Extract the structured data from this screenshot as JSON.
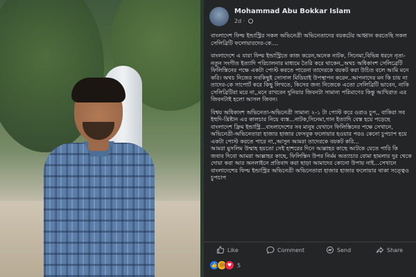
{
  "post": {
    "author": "Mohammad Abu Bokkar Islam",
    "time": "2d",
    "separator": "·",
    "paragraphs": [
      "বাংলাদেশ ফিল্ম ইন্ডাস্ট্রির সকল অভিনেত্রী অভিনেতাদের বয়কটের আহ্বান করতেছি সকল সেলিব্রিটি ফলোয়ারদের-কে....",
      "বাংলাদেশে এ যারা ফিল্ম ইন্ডাস্ট্রিতে কাজ করেন,অনেক নাটক, সিনেমা,বিভিন্ন ধরনে নৃত্য-নতুন সংগীত ইত্যাদি পরিচালনার মাধ্যমে তৈরি করে থাকেন,,অথচ অধিকাংশ সেলিব্রেটি ফিলিস্তিনের পক্ষে একটা পোস্ট করতে পারেনা তাদেরকে বয়কট করা উচিত বলে আমি মনে করি। অথচ নিজের সবকিছুই সোসাল মিডিয়াই উপস্থাপন করেন..আপনাদের মন কি চায় না তাদের-কে সাপোর্ট করে কিছু লিখতে, কিসের জন্য নিজেকে এতো সেলিব্রিটি ভাবেন, নাকি সেলিব্রিটিরা মরে না,,মনে রাখবেন দুনিয়ার জিবনটা সামান্য পরিমাণের কিন্তু আখিরাত এর জিবনটাই হলো আসল জিবন।",
      "বিশ্বয় অধিকাংশ অভিনেতা-অভিনেত্রী সামান্য ২-১ টা পোস্ট করে ওরাও চুপ,, বাকিরা সব ইহুদি-খ্রিষ্টান এর কালচার নিয়ে ব্যস্ত...নাটক,সিনেমা,গান ইত্যাদি বেস্ত হয়ে পড়েছে বাংলাদেশ ফ্রিম ইন্ডাস্ট্রি...বাংলাদেশের সব মানুষ যেখানে ফিলিস্তিনের পক্ষে সেখানে, অভিনেত্রী-অভিনেতারা হাজার হাজার ফেসবুক ফলোয়ার হওয়ার পরও কেনো চুপচাপ হয়ে একটা পোস্ট করতে পারে না,,আসুন আমরা তাদেরকে বয়কট করি...",
      "আমরা মুসলিম উম্মাহ হয়তো সেই হাশরের দিনে আল্লাহর কাছে আটকে যেতে পারি কি জবাব দিবো আমরা আল্লাহর কাছে, ফিলিস্তিন উপর নির্মম অত্যাচার বোমা হামলার দুর থেকে দোয়া করা আর অনলাইনে প্রতিবাদ করা ছাড়া আমাদের কোনো উপায় নাই...সেখানে বাংলাদেশের ফিল্ম ইন্ডাস্ট্রির অভিনেত্রী অভিনেতারা হাজার হাজার ফলোয়ার থাকা সত্ত্বেও চুপচাপ"
    ],
    "actions": {
      "like": "Like",
      "comment": "Comment",
      "send": "Send",
      "share": "Share"
    },
    "reaction_count": "5"
  },
  "icons": {
    "like": "thumbs-up-icon",
    "comment": "comment-icon",
    "send": "messenger-icon",
    "share": "share-icon",
    "privacy": "globe-icon"
  },
  "colors": {
    "post_bg": "#242526",
    "text": "#e4e6eb",
    "muted": "#b0b3b8",
    "like_blue": "#2078f4"
  }
}
